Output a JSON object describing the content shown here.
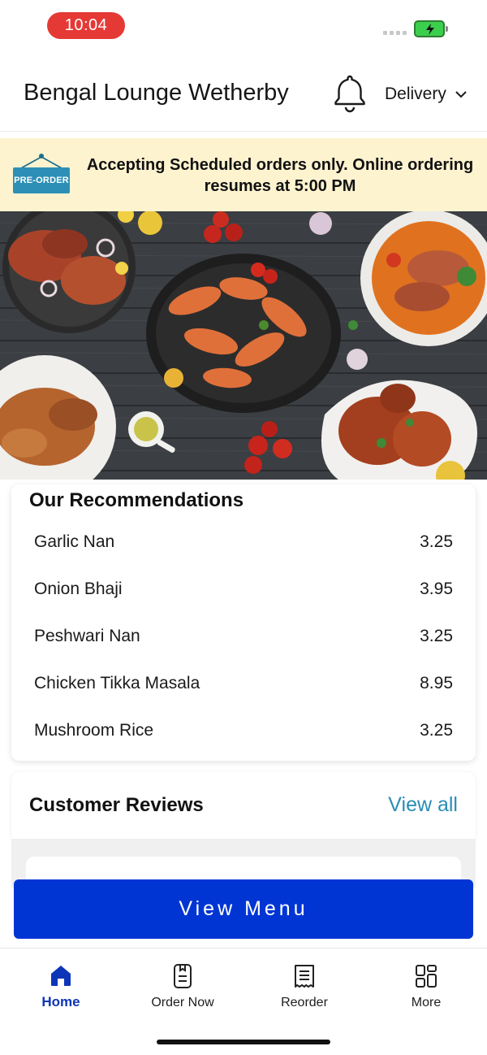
{
  "status_bar": {
    "time": "10:04"
  },
  "header": {
    "restaurant_name": "Bengal Lounge Wetherby",
    "mode_label": "Delivery"
  },
  "banner": {
    "badge_label": "PRE-ORDER",
    "message": "Accepting Scheduled orders only. Online ordering resumes at 5:00 PM"
  },
  "recommendations": {
    "title": "Our Recommendations",
    "items": [
      {
        "name": "Garlic Nan",
        "price": "3.25"
      },
      {
        "name": "Onion Bhaji",
        "price": "3.95"
      },
      {
        "name": "Peshwari Nan",
        "price": "3.25"
      },
      {
        "name": "Chicken Tikka Masala",
        "price": "8.95"
      },
      {
        "name": "Mushroom Rice",
        "price": "3.25"
      }
    ]
  },
  "reviews": {
    "title": "Customer Reviews",
    "view_all_label": "View all"
  },
  "view_menu_label": "View Menu",
  "tabbar": {
    "tabs": [
      {
        "label": "Home",
        "icon": "home-icon",
        "active": true
      },
      {
        "label": "Order Now",
        "icon": "order-icon",
        "active": false
      },
      {
        "label": "Reorder",
        "icon": "receipt-icon",
        "active": false
      },
      {
        "label": "More",
        "icon": "grid-icon",
        "active": false
      }
    ]
  },
  "colors": {
    "time_pill": "#e53935",
    "banner_bg": "#fdf3cf",
    "primary_button": "#0035d4",
    "link": "#2a8db5",
    "active_tab": "#0d35b8"
  }
}
